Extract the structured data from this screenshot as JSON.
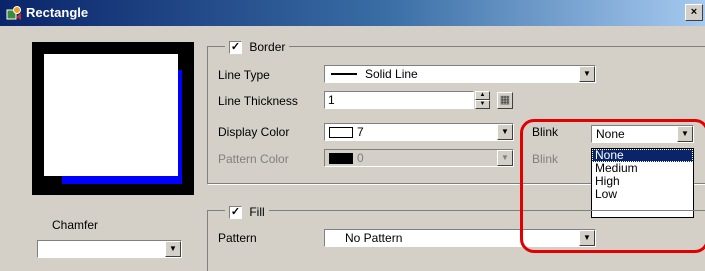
{
  "window": {
    "title": "Rectangle",
    "close_label": "×"
  },
  "colors": {
    "accent_highlight": "#e00000",
    "preview_border": "#0000ff",
    "selection": "#0a246a"
  },
  "border_group": {
    "checkbox_checked": true,
    "label": "Border",
    "line_type": {
      "label": "Line Type",
      "value": "Solid Line"
    },
    "line_thickness": {
      "label": "Line Thickness",
      "value": "1"
    },
    "display_color": {
      "label": "Display Color",
      "value": "7"
    },
    "pattern_color": {
      "label": "Pattern Color",
      "value": "0"
    },
    "blink": {
      "label": "Blink",
      "value": "None"
    },
    "blink2": {
      "label": "Blink"
    }
  },
  "blink_dropdown": {
    "options": [
      "None",
      "Medium",
      "High",
      "Low"
    ],
    "selected_index": 0
  },
  "fill_group": {
    "checkbox_checked": true,
    "label": "Fill",
    "pattern": {
      "label": "Pattern",
      "value": "No Pattern"
    }
  },
  "chamfer": {
    "label": "Chamfer"
  },
  "icons": {
    "checkbox_mark": "✓",
    "dropdown_arrow": "▼",
    "spin_up": "▲",
    "spin_down": "▼",
    "keypad": "▦"
  }
}
